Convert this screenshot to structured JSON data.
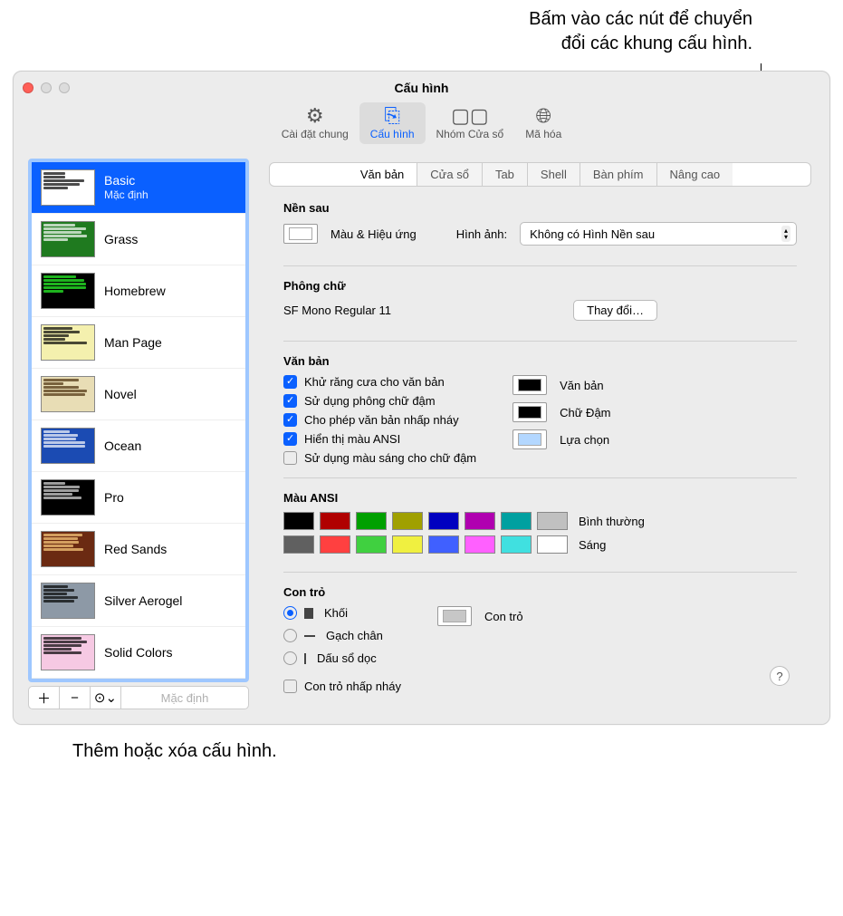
{
  "callouts": {
    "top": "Bấm vào các nút để chuyển\nđổi các khung cấu hình.",
    "bottom": "Thêm hoặc xóa cấu hình."
  },
  "window": {
    "title": "Cấu hình"
  },
  "toolbar": {
    "general": "Cài đặt chung",
    "profiles": "Cấu hình",
    "window_groups": "Nhóm Cửa sổ",
    "encoding": "Mã hóa"
  },
  "sidebar": {
    "selected_subtitle": "Mặc định",
    "items": [
      {
        "name": "Basic",
        "bg": "#ffffff",
        "fg": "#000"
      },
      {
        "name": "Grass",
        "bg": "#1f7a1f",
        "fg": "#fff"
      },
      {
        "name": "Homebrew",
        "bg": "#000",
        "fg": "#2bff2b"
      },
      {
        "name": "Man Page",
        "bg": "#f4f0ae",
        "fg": "#000"
      },
      {
        "name": "Novel",
        "bg": "#e8ddb5",
        "fg": "#4a2d0a"
      },
      {
        "name": "Ocean",
        "bg": "#1b4bb3",
        "fg": "#fff"
      },
      {
        "name": "Pro",
        "bg": "#000",
        "fg": "#e0e0e0"
      },
      {
        "name": "Red Sands",
        "bg": "#6b2a12",
        "fg": "#ffd080"
      },
      {
        "name": "Silver Aerogel",
        "bg": "#8d99a6",
        "fg": "#000"
      },
      {
        "name": "Solid Colors",
        "bg": "#f6c9e3",
        "fg": "#000"
      }
    ],
    "footer_default": "Mặc định"
  },
  "tabs": {
    "text": "Văn bản",
    "window": "Cửa sổ",
    "tab": "Tab",
    "shell": "Shell",
    "keyboard": "Bàn phím",
    "advanced": "Nâng cao"
  },
  "sections": {
    "background": {
      "title": "Nền sau",
      "color_effects": "Màu & Hiệu ứng",
      "image_label": "Hình ảnh:",
      "image_value": "Không có Hình Nền sau"
    },
    "font": {
      "title": "Phông chữ",
      "value": "SF Mono Regular 11",
      "change": "Thay đổi…"
    },
    "text": {
      "title": "Văn bản",
      "antialias": "Khử răng cưa cho văn bản",
      "bold_fonts": "Sử dụng phông chữ đậm",
      "blink": "Cho phép văn bản nhấp nháy",
      "ansi": "Hiển thị màu ANSI",
      "bright_bold": "Sử dụng màu sáng cho chữ đậm",
      "color_text": "Văn bản",
      "color_bold": "Chữ Đậm",
      "color_selection": "Lựa chọn"
    },
    "ansi": {
      "title": "Màu ANSI",
      "normal": "Bình thường",
      "bright": "Sáng",
      "normal_colors": [
        "#000000",
        "#b00000",
        "#00a000",
        "#a0a000",
        "#0000c0",
        "#b000b0",
        "#00a0a0",
        "#c0c0c0"
      ],
      "bright_colors": [
        "#606060",
        "#ff4040",
        "#40d040",
        "#f0f040",
        "#4060ff",
        "#ff60ff",
        "#40e0e0",
        "#ffffff"
      ]
    },
    "cursor": {
      "title": "Con trỏ",
      "block": "Khối",
      "underline": "Gạch chân",
      "vbar": "Dấu sổ dọc",
      "blink": "Con trỏ nhấp nháy",
      "color_label": "Con trỏ"
    }
  }
}
